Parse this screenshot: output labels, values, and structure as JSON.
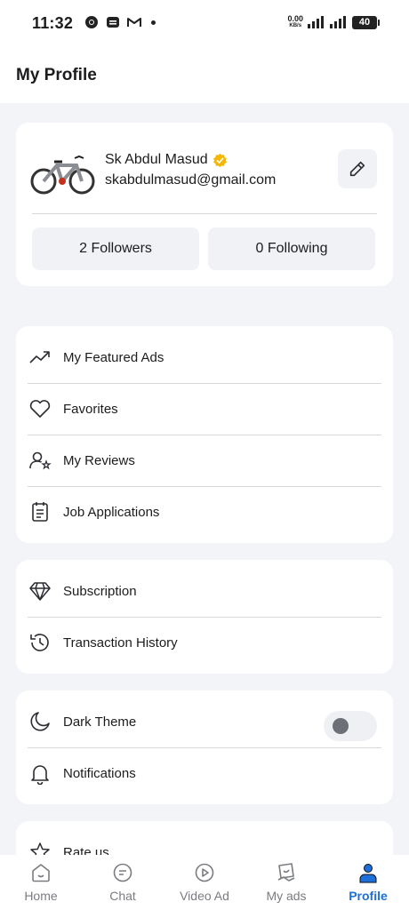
{
  "status_bar": {
    "time": "11:32",
    "net_speed_value": "0.00",
    "net_speed_unit": "KB/s",
    "battery": "40"
  },
  "header": {
    "title": "My Profile"
  },
  "profile": {
    "name": "Sk Abdul Masud",
    "email": "skabdulmasud@gmail.com",
    "followers_label": "2 Followers",
    "following_label": "0 Following",
    "verified": true,
    "edit_icon": "pencil-icon"
  },
  "menu_group_1": [
    {
      "label": "My Featured Ads",
      "icon": "trending-up-icon"
    },
    {
      "label": "Favorites",
      "icon": "heart-icon"
    },
    {
      "label": "My Reviews",
      "icon": "user-star-icon"
    },
    {
      "label": "Job Applications",
      "icon": "clipboard-icon"
    }
  ],
  "menu_group_2": [
    {
      "label": "Subscription",
      "icon": "diamond-icon"
    },
    {
      "label": "Transaction History",
      "icon": "history-icon"
    }
  ],
  "menu_group_3": [
    {
      "label": "Dark Theme",
      "icon": "moon-icon",
      "toggle_on": false
    },
    {
      "label": "Notifications",
      "icon": "bell-icon"
    }
  ],
  "menu_group_4": [
    {
      "label": "Rate us",
      "icon": "star-icon"
    }
  ],
  "bottom_nav": [
    {
      "label": "Home",
      "icon": "home-icon",
      "active": false
    },
    {
      "label": "Chat",
      "icon": "chat-icon",
      "active": false
    },
    {
      "label": "Video Ad",
      "icon": "play-icon",
      "active": false
    },
    {
      "label": "My ads",
      "icon": "my-ads-icon",
      "active": false
    },
    {
      "label": "Profile",
      "icon": "profile-icon",
      "active": true
    }
  ],
  "colors": {
    "accent": "#1e6fd9",
    "background": "#f2f4f8",
    "card": "#ffffff",
    "verified_badge": "#f5b800"
  }
}
